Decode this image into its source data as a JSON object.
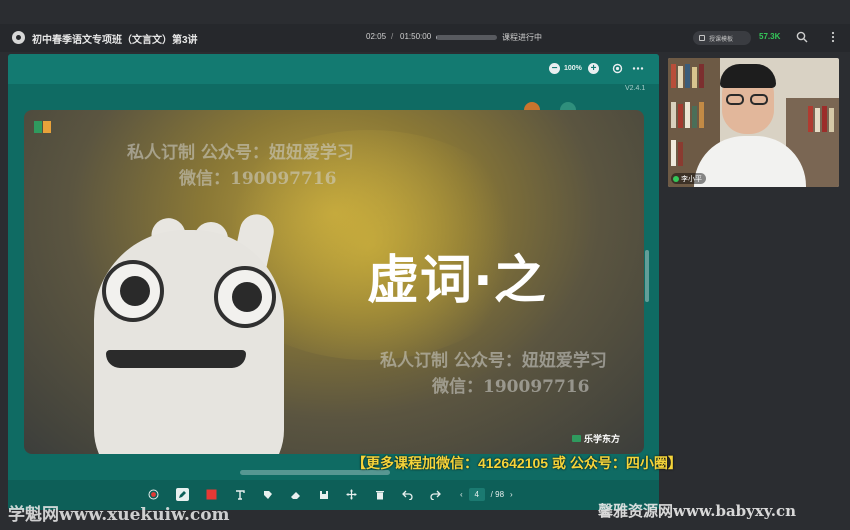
{
  "topbar": {
    "course_title": "初中春季语文专项班（文言文）第3讲",
    "time_current": "02:05",
    "time_separator": "/",
    "time_total": "01:50:00",
    "progress_fraction": 0.02,
    "status": "课程进行中",
    "mode_label": "授课模板",
    "viewers": "57.3K"
  },
  "board": {
    "zoom": "100%",
    "version": "V2.4.1",
    "slide": {
      "title": "虚词·之",
      "watermark_1_line1": "私人订制 公众号：妞妞爱学习",
      "watermark_1_line2": "微信：190097716",
      "watermark_2_line1": "私人订制 公众号：妞妞爱学习",
      "watermark_2_line2": "微信：190097716",
      "brand": "乐学东方"
    },
    "page_current": "4",
    "page_total": "/ 98"
  },
  "promo": "【更多课程加微信：412642105 或 公众号：四小圈】",
  "video": {
    "teacher_name": "李小平"
  },
  "footer": {
    "site_left": "学魁网www.xuekuiw.com",
    "site_right": "馨雅资源网www.babyxy.cn"
  },
  "icons": [
    "app-logo-icon",
    "search-icon",
    "more-icon",
    "zoom-out-icon",
    "zoom-in-icon",
    "fit-icon",
    "pen-icon",
    "color-icon",
    "text-icon",
    "tag-icon",
    "eraser-icon",
    "save-icon",
    "move-icon",
    "trash-icon",
    "undo-icon",
    "redo-icon"
  ],
  "colors": {
    "board": "#0f6b63",
    "accent_green": "#34c759",
    "promo": "#f5d43a",
    "tool_red": "#e53935"
  }
}
